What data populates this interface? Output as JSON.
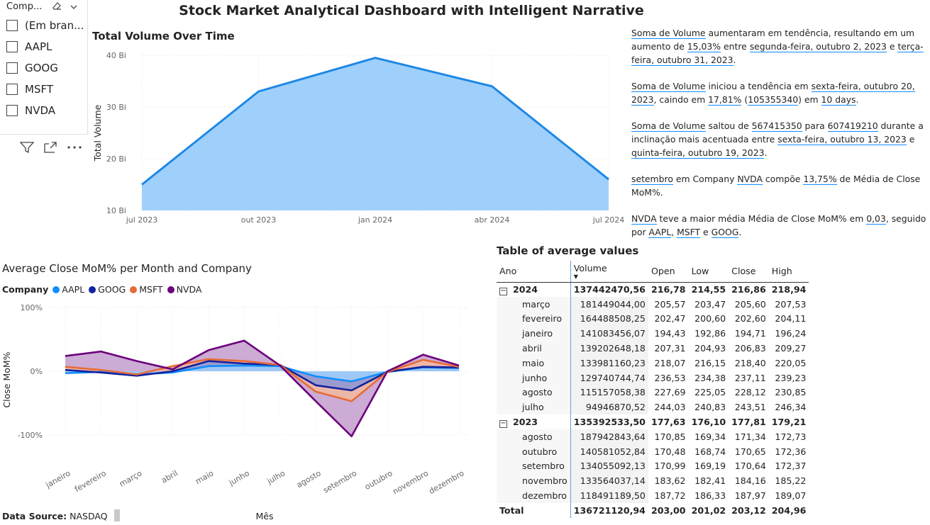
{
  "dashboard_title": "Stock Market Analytical Dashboard with Intelligent Narrative",
  "slicer": {
    "header": "Comp...",
    "items": [
      "(Em bran...",
      "AAPL",
      "GOOG",
      "MSFT",
      "NVDA"
    ]
  },
  "icons": [
    "eraser-icon",
    "chevron-down-icon",
    "filter-icon",
    "focus-mode-icon",
    "more-options-icon"
  ],
  "volume_chart": {
    "title": "Total Volume Over Time"
  },
  "narrative": {
    "p1": [
      "Soma de Volume",
      " aumentaram em tendência, resultando em um aumento de ",
      "15,03%",
      " entre ",
      "segunda-feira, outubro 2, 2023",
      " e ",
      "terça-feira, outubro 31, 2023",
      "."
    ],
    "p2": [
      "Soma de Volume",
      " iniciou a tendência em ",
      "sexta-feira, outubro 20, 2023",
      ", caindo em ",
      "17,81%",
      " (",
      "105355340",
      ") em ",
      "10 days",
      "."
    ],
    "p3": [
      "Soma de Volume",
      " saltou de ",
      "567415350",
      " para ",
      "607419210",
      " durante a inclinação mais acentuada entre ",
      "sexta-feira, outubro 13, 2023",
      " e ",
      "quinta-feira, outubro 19, 2023",
      "."
    ],
    "p4": [
      "setembro",
      " em Company ",
      "NVDA",
      " compõe ",
      "13,75%",
      " de Média de Close MoM%."
    ],
    "p5": [
      "NVDA",
      " teve a maior média Média de Close MoM% em ",
      "0,03",
      ", seguido por ",
      "AAPL",
      ", ",
      "MSFT",
      " e ",
      "GOOG",
      "."
    ]
  },
  "mom_chart": {
    "title": "Average Close MoM% per Month and Company",
    "legend_label": "Company",
    "data_source_label": "Data Source:",
    "data_source_value": "NASDAQ"
  },
  "table": {
    "title": "Table of average values",
    "columns": [
      "Ano",
      "Volume",
      "Open",
      "Low",
      "Close",
      "High"
    ],
    "groups": [
      {
        "year": "2024",
        "values": [
          "137442470,56",
          "216,78",
          "214,55",
          "216,86",
          "218,94"
        ],
        "rows": [
          {
            "name": "março",
            "values": [
              "181449044,00",
              "205,57",
              "203,47",
              "205,60",
              "207,53"
            ]
          },
          {
            "name": "fevereiro",
            "values": [
              "164488508,25",
              "202,47",
              "200,60",
              "202,60",
              "204,11"
            ]
          },
          {
            "name": "janeiro",
            "values": [
              "141083456,07",
              "194,43",
              "192,86",
              "194,71",
              "196,24"
            ]
          },
          {
            "name": "abril",
            "values": [
              "139202648,18",
              "207,31",
              "204,93",
              "206,83",
              "209,27"
            ]
          },
          {
            "name": "maio",
            "values": [
              "133981160,23",
              "218,07",
              "216,15",
              "218,40",
              "220,05"
            ]
          },
          {
            "name": "junho",
            "values": [
              "129740744,74",
              "236,53",
              "234,38",
              "237,11",
              "239,23"
            ]
          },
          {
            "name": "agosto",
            "values": [
              "115157058,38",
              "227,69",
              "225,05",
              "228,12",
              "230,85"
            ]
          },
          {
            "name": "julho",
            "values": [
              "94946870,52",
              "244,03",
              "240,83",
              "243,51",
              "246,34"
            ]
          }
        ]
      },
      {
        "year": "2023",
        "values": [
          "135392533,50",
          "177,63",
          "176,10",
          "177,81",
          "179,21"
        ],
        "rows": [
          {
            "name": "agosto",
            "values": [
              "187942843,64",
              "170,85",
              "169,34",
              "171,34",
              "172,73"
            ]
          },
          {
            "name": "outubro",
            "values": [
              "140581052,84",
              "170,48",
              "168,74",
              "170,65",
              "172,36"
            ]
          },
          {
            "name": "setembro",
            "values": [
              "134055092,13",
              "170,99",
              "169,19",
              "170,64",
              "172,37"
            ]
          },
          {
            "name": "novembro",
            "values": [
              "133564037,14",
              "183,62",
              "182,41",
              "184,16",
              "185,22"
            ]
          },
          {
            "name": "dezembro",
            "values": [
              "118491189,50",
              "187,72",
              "186,33",
              "187,97",
              "189,07"
            ]
          }
        ]
      }
    ],
    "total": {
      "name": "Total",
      "values": [
        "136721120,94",
        "203,00",
        "201,02",
        "203,12",
        "204,96"
      ]
    }
  },
  "chart_data": [
    {
      "type": "area",
      "title": "Total Volume Over Time",
      "xlabel": "",
      "ylabel": "Total Volume",
      "x": [
        "jul 2023",
        "out 2023",
        "jan 2024",
        "abr 2024",
        "jul 2024"
      ],
      "values": [
        15,
        33,
        39.5,
        34,
        16
      ],
      "unit": "Bi",
      "ylim": [
        10,
        40
      ],
      "yticks": [
        "10 Bi",
        "20 Bi",
        "30 Bi",
        "40 Bi"
      ],
      "color": "#1e88e5",
      "fill": "#9fd0fb",
      "grid": true
    },
    {
      "type": "area",
      "title": "Average Close MoM% per Month and Company",
      "xlabel": "Mês",
      "ylabel": "Close MoM%",
      "categories": [
        "janeiro",
        "fevereiro",
        "março",
        "abril",
        "maio",
        "junho",
        "julho",
        "agosto",
        "setembro",
        "outubro",
        "novembro",
        "dezembro"
      ],
      "ylim": [
        -100,
        100
      ],
      "yticks": [
        "-100%",
        "0%",
        "100%"
      ],
      "series": [
        {
          "name": "AAPL",
          "color": "#118dff",
          "values": [
            -3,
            -1,
            -5,
            -2,
            8,
            9,
            8,
            -8,
            -16,
            -1,
            6,
            5
          ]
        },
        {
          "name": "GOOG",
          "color": "#12239e",
          "values": [
            2,
            -2,
            -7,
            0,
            16,
            12,
            10,
            -22,
            -30,
            -1,
            7,
            6
          ]
        },
        {
          "name": "MSFT",
          "color": "#e66c37",
          "values": [
            7,
            2,
            -5,
            8,
            19,
            16,
            10,
            -32,
            -47,
            -1,
            18,
            7
          ]
        },
        {
          "name": "NVDA",
          "color": "#6b007b",
          "values": [
            24,
            31,
            16,
            3,
            33,
            48,
            9,
            -47,
            -102,
            0,
            26,
            9
          ]
        }
      ],
      "legend_position": "top-left",
      "grid": true
    }
  ]
}
